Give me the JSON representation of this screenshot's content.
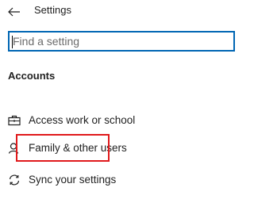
{
  "header": {
    "back_icon": "arrow-left-icon",
    "title": "Settings"
  },
  "search": {
    "placeholder": "Find a setting",
    "value": ""
  },
  "section": {
    "heading": "Accounts"
  },
  "nav": {
    "items": [
      {
        "icon": "briefcase-icon",
        "label": "Access work or school"
      },
      {
        "icon": "person-icon",
        "label": "Family & other users",
        "highlighted": true
      },
      {
        "icon": "sync-icon",
        "label": "Sync your settings"
      }
    ]
  },
  "colors": {
    "search_border": "#0066b4",
    "highlight_border": "#e0191b",
    "text": "#1f1f1f"
  }
}
